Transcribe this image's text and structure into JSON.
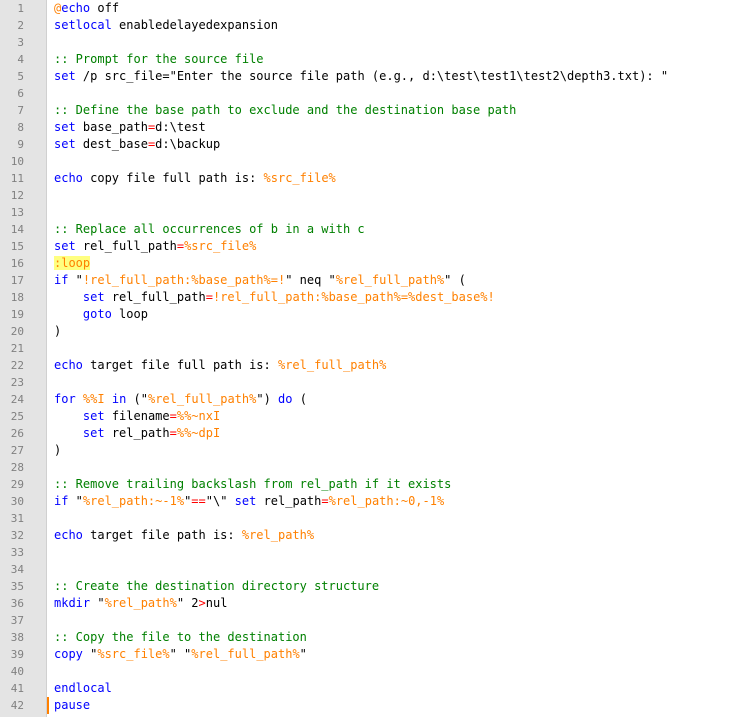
{
  "editor": {
    "lines": [
      {
        "n": "1",
        "tokens": [
          {
            "c": "var",
            "t": "@"
          },
          {
            "c": "kw",
            "t": "echo"
          },
          {
            "c": "",
            "t": " off"
          }
        ]
      },
      {
        "n": "2",
        "tokens": [
          {
            "c": "kw",
            "t": "setlocal"
          },
          {
            "c": "",
            "t": " enabledelayedexpansion"
          }
        ]
      },
      {
        "n": "3",
        "tokens": []
      },
      {
        "n": "4",
        "tokens": [
          {
            "c": "cm",
            "t": ":: Prompt for the source file"
          }
        ]
      },
      {
        "n": "5",
        "tokens": [
          {
            "c": "kw",
            "t": "set"
          },
          {
            "c": "",
            "t": " /p src_file="
          },
          {
            "c": "",
            "t": "\"Enter the source file path (e.g., d:\\test\\test1\\test2\\depth3.txt): \""
          }
        ]
      },
      {
        "n": "6",
        "tokens": []
      },
      {
        "n": "7",
        "tokens": [
          {
            "c": "cm",
            "t": ":: Define the base path to exclude and the destination base path"
          }
        ]
      },
      {
        "n": "8",
        "tokens": [
          {
            "c": "kw",
            "t": "set"
          },
          {
            "c": "",
            "t": " base_path"
          },
          {
            "c": "op",
            "t": "="
          },
          {
            "c": "",
            "t": "d:\\test"
          }
        ]
      },
      {
        "n": "9",
        "tokens": [
          {
            "c": "kw",
            "t": "set"
          },
          {
            "c": "",
            "t": " dest_base"
          },
          {
            "c": "op",
            "t": "="
          },
          {
            "c": "",
            "t": "d:\\backup"
          }
        ]
      },
      {
        "n": "10",
        "tokens": []
      },
      {
        "n": "11",
        "tokens": [
          {
            "c": "kw",
            "t": "echo"
          },
          {
            "c": "",
            "t": " copy file full path is: "
          },
          {
            "c": "var",
            "t": "%src_file%"
          }
        ]
      },
      {
        "n": "12",
        "tokens": []
      },
      {
        "n": "13",
        "tokens": []
      },
      {
        "n": "14",
        "tokens": [
          {
            "c": "cm",
            "t": ":: Replace all occurrences of b in a with c"
          }
        ]
      },
      {
        "n": "15",
        "tokens": [
          {
            "c": "kw",
            "t": "set"
          },
          {
            "c": "",
            "t": " rel_full_path"
          },
          {
            "c": "op",
            "t": "="
          },
          {
            "c": "var",
            "t": "%src_file%"
          }
        ]
      },
      {
        "n": "16",
        "tokens": [
          {
            "c": "lbl",
            "t": ":loop"
          }
        ]
      },
      {
        "n": "17",
        "tokens": [
          {
            "c": "kw",
            "t": "if"
          },
          {
            "c": "",
            "t": " \""
          },
          {
            "c": "var",
            "t": "!rel_full_path:%base_path%=!"
          },
          {
            "c": "",
            "t": "\" neq \""
          },
          {
            "c": "var",
            "t": "%rel_full_path%"
          },
          {
            "c": "",
            "t": "\" ("
          }
        ]
      },
      {
        "n": "18",
        "tokens": [
          {
            "c": "",
            "t": "    "
          },
          {
            "c": "kw",
            "t": "set"
          },
          {
            "c": "",
            "t": " rel_full_path"
          },
          {
            "c": "op",
            "t": "="
          },
          {
            "c": "var",
            "t": "!rel_full_path:%base_path%=%dest_base%!"
          }
        ]
      },
      {
        "n": "19",
        "tokens": [
          {
            "c": "",
            "t": "    "
          },
          {
            "c": "kw",
            "t": "goto"
          },
          {
            "c": "",
            "t": " loop"
          }
        ]
      },
      {
        "n": "20",
        "tokens": [
          {
            "c": "",
            "t": ")"
          }
        ]
      },
      {
        "n": "21",
        "tokens": []
      },
      {
        "n": "22",
        "tokens": [
          {
            "c": "kw",
            "t": "echo"
          },
          {
            "c": "",
            "t": " target file full path is: "
          },
          {
            "c": "var",
            "t": "%rel_full_path%"
          }
        ]
      },
      {
        "n": "23",
        "tokens": []
      },
      {
        "n": "24",
        "tokens": [
          {
            "c": "kw",
            "t": "for"
          },
          {
            "c": "",
            "t": " "
          },
          {
            "c": "var",
            "t": "%%I"
          },
          {
            "c": "",
            "t": " "
          },
          {
            "c": "kw",
            "t": "in"
          },
          {
            "c": "",
            "t": " (\""
          },
          {
            "c": "var",
            "t": "%rel_full_path%"
          },
          {
            "c": "",
            "t": "\") "
          },
          {
            "c": "kw",
            "t": "do"
          },
          {
            "c": "",
            "t": " ("
          }
        ]
      },
      {
        "n": "25",
        "tokens": [
          {
            "c": "",
            "t": "    "
          },
          {
            "c": "kw",
            "t": "set"
          },
          {
            "c": "",
            "t": " filename"
          },
          {
            "c": "op",
            "t": "="
          },
          {
            "c": "var",
            "t": "%%~nxI"
          }
        ]
      },
      {
        "n": "26",
        "tokens": [
          {
            "c": "",
            "t": "    "
          },
          {
            "c": "kw",
            "t": "set"
          },
          {
            "c": "",
            "t": " rel_path"
          },
          {
            "c": "op",
            "t": "="
          },
          {
            "c": "var",
            "t": "%%~dpI"
          }
        ]
      },
      {
        "n": "27",
        "tokens": [
          {
            "c": "",
            "t": ")"
          }
        ]
      },
      {
        "n": "28",
        "tokens": []
      },
      {
        "n": "29",
        "tokens": [
          {
            "c": "cm",
            "t": ":: Remove trailing backslash from rel_path if it exists"
          }
        ]
      },
      {
        "n": "30",
        "tokens": [
          {
            "c": "kw",
            "t": "if"
          },
          {
            "c": "",
            "t": " \""
          },
          {
            "c": "var",
            "t": "%rel_path:~-1%"
          },
          {
            "c": "",
            "t": "\""
          },
          {
            "c": "op",
            "t": "=="
          },
          {
            "c": "",
            "t": "\"\\\" "
          },
          {
            "c": "kw",
            "t": "set"
          },
          {
            "c": "",
            "t": " rel_path"
          },
          {
            "c": "op",
            "t": "="
          },
          {
            "c": "var",
            "t": "%rel_path:~0,-1%"
          }
        ]
      },
      {
        "n": "31",
        "tokens": []
      },
      {
        "n": "32",
        "tokens": [
          {
            "c": "kw",
            "t": "echo"
          },
          {
            "c": "",
            "t": " target file path is: "
          },
          {
            "c": "var",
            "t": "%rel_path%"
          }
        ]
      },
      {
        "n": "33",
        "tokens": []
      },
      {
        "n": "34",
        "tokens": []
      },
      {
        "n": "35",
        "tokens": [
          {
            "c": "cm",
            "t": ":: Create the destination directory structure"
          }
        ]
      },
      {
        "n": "36",
        "tokens": [
          {
            "c": "kw",
            "t": "mkdir"
          },
          {
            "c": "",
            "t": " \""
          },
          {
            "c": "var",
            "t": "%rel_path%"
          },
          {
            "c": "",
            "t": "\" 2"
          },
          {
            "c": "op",
            "t": ">"
          },
          {
            "c": "",
            "t": "nul"
          }
        ]
      },
      {
        "n": "37",
        "tokens": []
      },
      {
        "n": "38",
        "tokens": [
          {
            "c": "cm",
            "t": ":: Copy the file to the destination"
          }
        ]
      },
      {
        "n": "39",
        "tokens": [
          {
            "c": "kw",
            "t": "copy"
          },
          {
            "c": "",
            "t": " \""
          },
          {
            "c": "var",
            "t": "%src_file%"
          },
          {
            "c": "",
            "t": "\" \""
          },
          {
            "c": "var",
            "t": "%rel_full_path%"
          },
          {
            "c": "",
            "t": "\""
          }
        ]
      },
      {
        "n": "40",
        "tokens": []
      },
      {
        "n": "41",
        "tokens": [
          {
            "c": "kw",
            "t": "endlocal"
          }
        ]
      },
      {
        "n": "42",
        "tokens": [
          {
            "c": "kw",
            "t": "pause"
          }
        ]
      }
    ]
  }
}
